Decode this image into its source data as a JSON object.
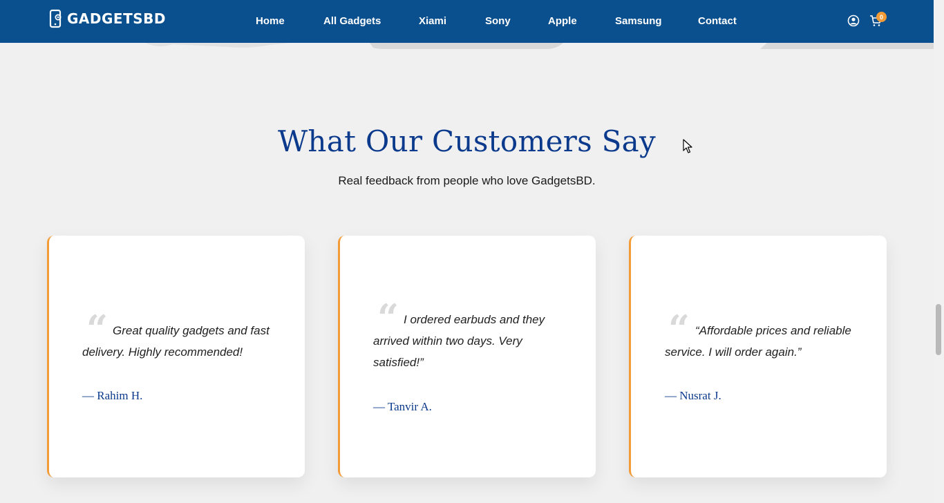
{
  "header": {
    "logo_text": "GADGETSBD",
    "nav": [
      "Home",
      "All Gadgets",
      "Xiami",
      "Sony",
      "Apple",
      "Samsung",
      "Contact"
    ],
    "cart_count": "0",
    "colors": {
      "bar": "#0a4f8e",
      "badge": "#f39c37"
    },
    "icons": [
      "user-icon",
      "cart-icon"
    ]
  },
  "section": {
    "title": "What Our Customers Say",
    "subtitle": "Real feedback from people who love GadgetsBD."
  },
  "testimonials": [
    {
      "quote": "Great quality gadgets and fast delivery. Highly recommended!",
      "author": "— Rahim H."
    },
    {
      "quote": "I ordered earbuds and they arrived within two days. Very satisfied!”",
      "author": "— Tanvir A."
    },
    {
      "quote": "“Affordable prices and reliable service. I will order again.”",
      "author": "— Nusrat J."
    }
  ],
  "colors": {
    "title": "#0b3a8c",
    "accent": "#f39c37",
    "background": "#f0f0f0"
  }
}
